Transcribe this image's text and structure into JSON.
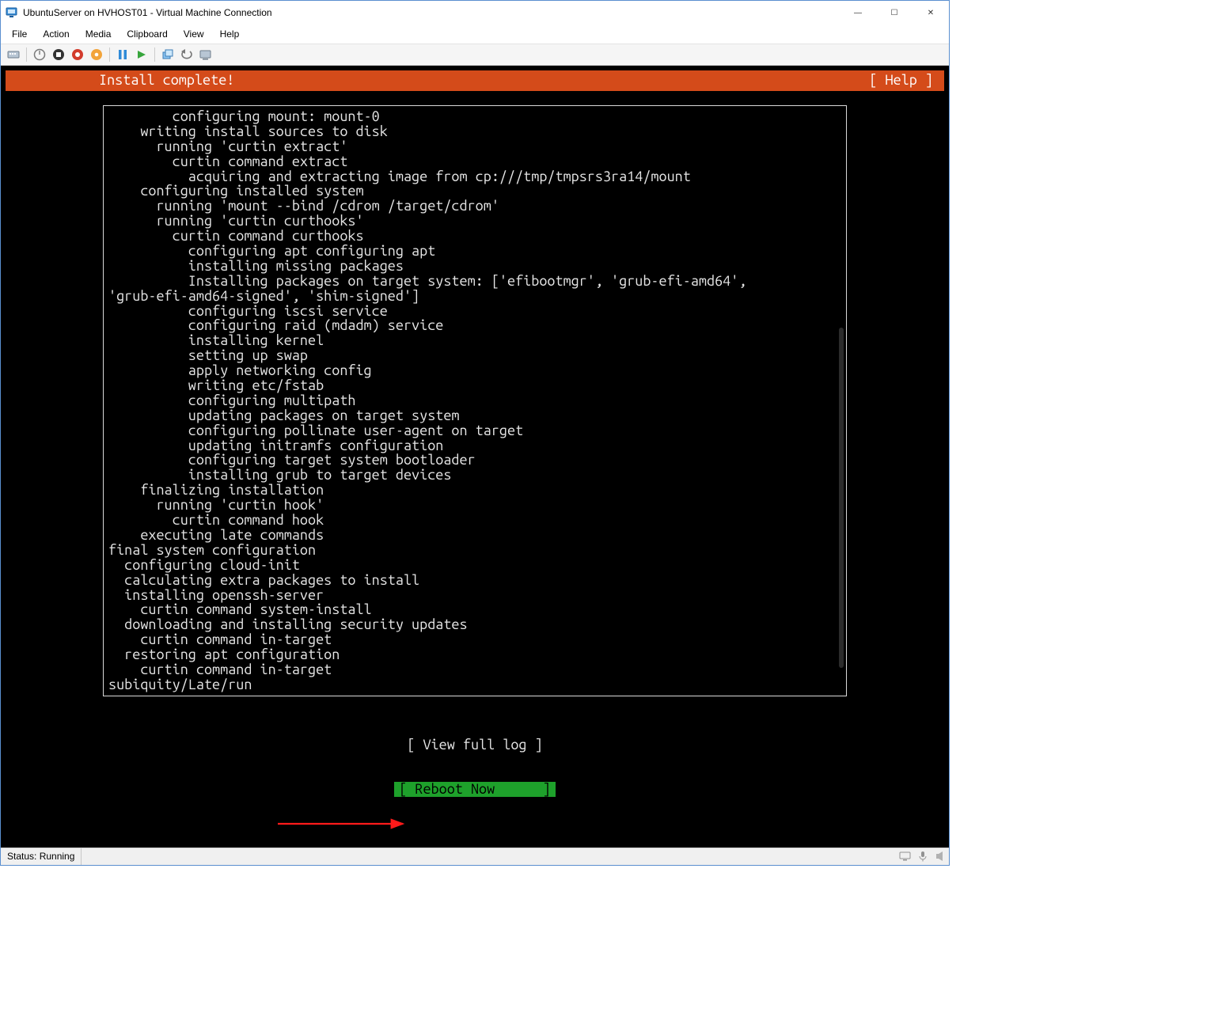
{
  "window": {
    "title": "UbuntuServer on HVHOST01 - Virtual Machine Connection",
    "controls": {
      "min": "—",
      "max": "☐",
      "close": "✕"
    }
  },
  "menubar": [
    "File",
    "Action",
    "Media",
    "Clipboard",
    "View",
    "Help"
  ],
  "toolbar_icons": [
    "ctrl-alt-del-icon",
    "start-icon",
    "turn-off-icon",
    "shut-down-icon",
    "save-icon",
    "pause-icon",
    "reset-icon",
    "checkpoint-icon",
    "revert-icon",
    "enhanced-session-icon"
  ],
  "installer": {
    "header": "Install complete!",
    "help": "[ Help ]",
    "log": "        configuring mount: mount-0\n    writing install sources to disk\n      running 'curtin extract'\n        curtin command extract\n          acquiring and extracting image from cp:///tmp/tmpsrs3ra14/mount\n    configuring installed system\n      running 'mount --bind /cdrom /target/cdrom'\n      running 'curtin curthooks'\n        curtin command curthooks\n          configuring apt configuring apt\n          installing missing packages\n          Installing packages on target system: ['efibootmgr', 'grub-efi-amd64',\n'grub-efi-amd64-signed', 'shim-signed']\n          configuring iscsi service\n          configuring raid (mdadm) service\n          installing kernel\n          setting up swap\n          apply networking config\n          writing etc/fstab\n          configuring multipath\n          updating packages on target system\n          configuring pollinate user-agent on target\n          updating initramfs configuration\n          configuring target system bootloader\n          installing grub to target devices\n    finalizing installation\n      running 'curtin hook'\n        curtin command hook\n    executing late commands\nfinal system configuration\n  configuring cloud-init\n  calculating extra packages to install\n  installing openssh-server\n    curtin command system-install\n  downloading and installing security updates\n    curtin command in-target\n  restoring apt configuration\n    curtin command in-target\nsubiquity/Late/run",
    "option_view_log": "[ View full log ]",
    "option_reboot": "[ Reboot Now      ]"
  },
  "statusbar": {
    "status": "Status: Running"
  }
}
